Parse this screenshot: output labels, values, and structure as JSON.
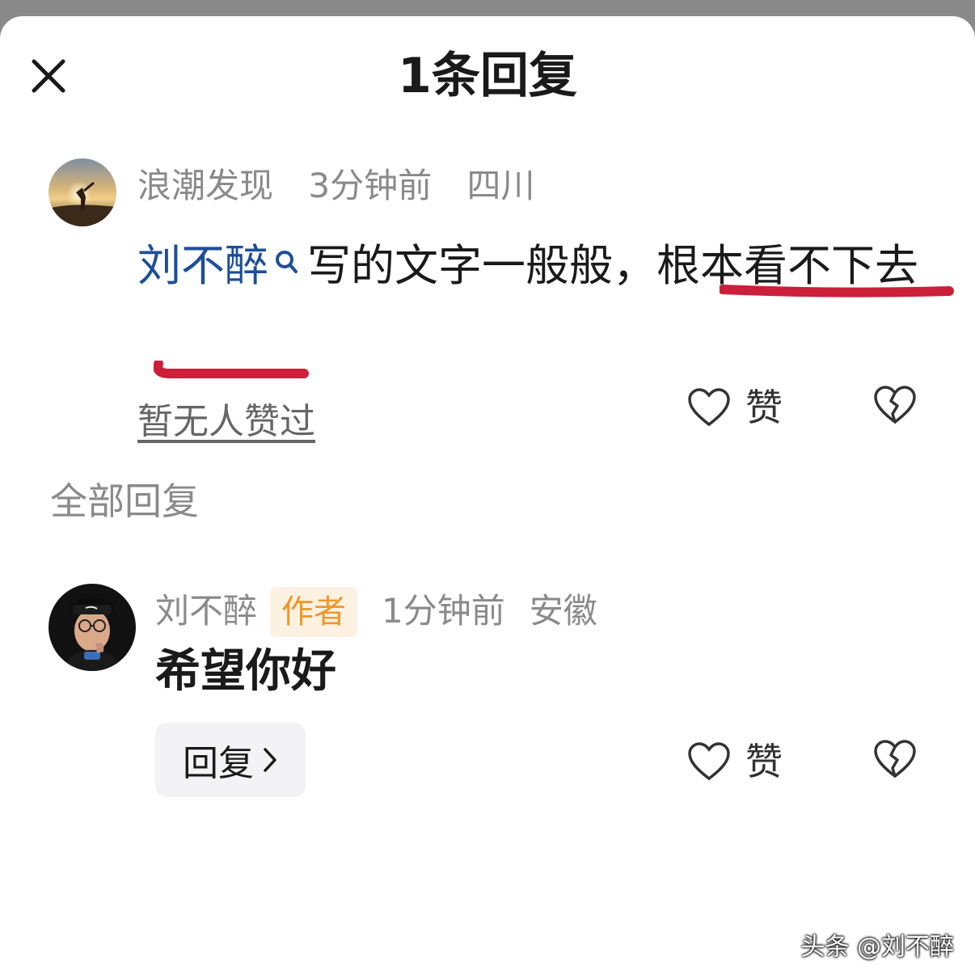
{
  "header": {
    "title": "1条回复"
  },
  "comment": {
    "username": "浪潮发现",
    "time": "3分钟前",
    "location": "四川",
    "mention": "刘不醉",
    "text_plain": "写的文字一般般，",
    "text_underlined_line1": "根本看不",
    "text_underlined_line2": "下去",
    "likes_status": "暂无人赞过",
    "like_label": "赞"
  },
  "section": {
    "title": "全部回复"
  },
  "reply": {
    "username": "刘不醉",
    "badge": "作者",
    "time": "1分钟前",
    "location": "安徽",
    "text": "希望你好",
    "reply_button_label": "回复",
    "like_label": "赞"
  },
  "watermark": "头条 @刘不醉",
  "colors": {
    "mention": "#1d4e9a",
    "underline": "#cc1f3a",
    "badge_bg": "#fdf1e2",
    "badge_text": "#f0972b"
  }
}
